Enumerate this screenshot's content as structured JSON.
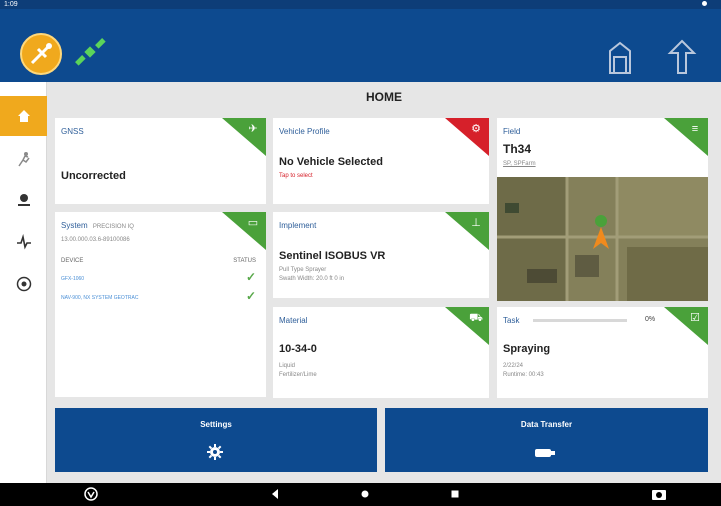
{
  "statusbar": {
    "time": "1:09"
  },
  "main": {
    "title": "HOME"
  },
  "cards": {
    "gnss": {
      "title": "GNSS",
      "value": "Uncorrected",
      "corner_icon": "satellite-icon"
    },
    "vehicle": {
      "title": "Vehicle Profile",
      "value": "No Vehicle Selected",
      "hint": "Tap to select",
      "corner_icon": "tractor-icon"
    },
    "field": {
      "title": "Field",
      "value": "Th34",
      "sub": "SP, SPFarm",
      "corner_icon": "field-icon"
    },
    "system": {
      "title": "System",
      "model": "PRECISION IQ",
      "version": "13.00.000.03.6-89100086",
      "col_device": "DEVICE",
      "col_status": "STATUS",
      "rows": [
        {
          "device": "GFX-1060"
        },
        {
          "device": "NAV-900, NX SYSTEM GEOTRAC"
        }
      ],
      "corner_icon": "display-icon"
    },
    "implement": {
      "title": "Implement",
      "value": "Sentinel ISOBUS VR",
      "line1": "Pull Type Sprayer",
      "line2": "Swath Width: 20.0 ft 0 in",
      "corner_icon": "implement-icon"
    },
    "material": {
      "title": "Material",
      "value": "10-34-0",
      "line1": "Liquid",
      "line2": "Fertilizer/Lime",
      "corner_icon": "material-icon"
    },
    "task": {
      "title": "Task",
      "percent": "0%",
      "progress": 0,
      "value": "Spraying",
      "line1": "2/22/24",
      "line2": "Runtime: 00:43",
      "corner_icon": "checklist-icon"
    }
  },
  "buttons": {
    "settings": {
      "label": "Settings",
      "icon": "gear-icon"
    },
    "data_transfer": {
      "label": "Data Transfer",
      "icon": "usb-drive-icon"
    }
  },
  "colors": {
    "primary": "#0d4a8f",
    "accent": "#f0a91d",
    "green": "#4aa13a",
    "red": "#d6202a"
  }
}
